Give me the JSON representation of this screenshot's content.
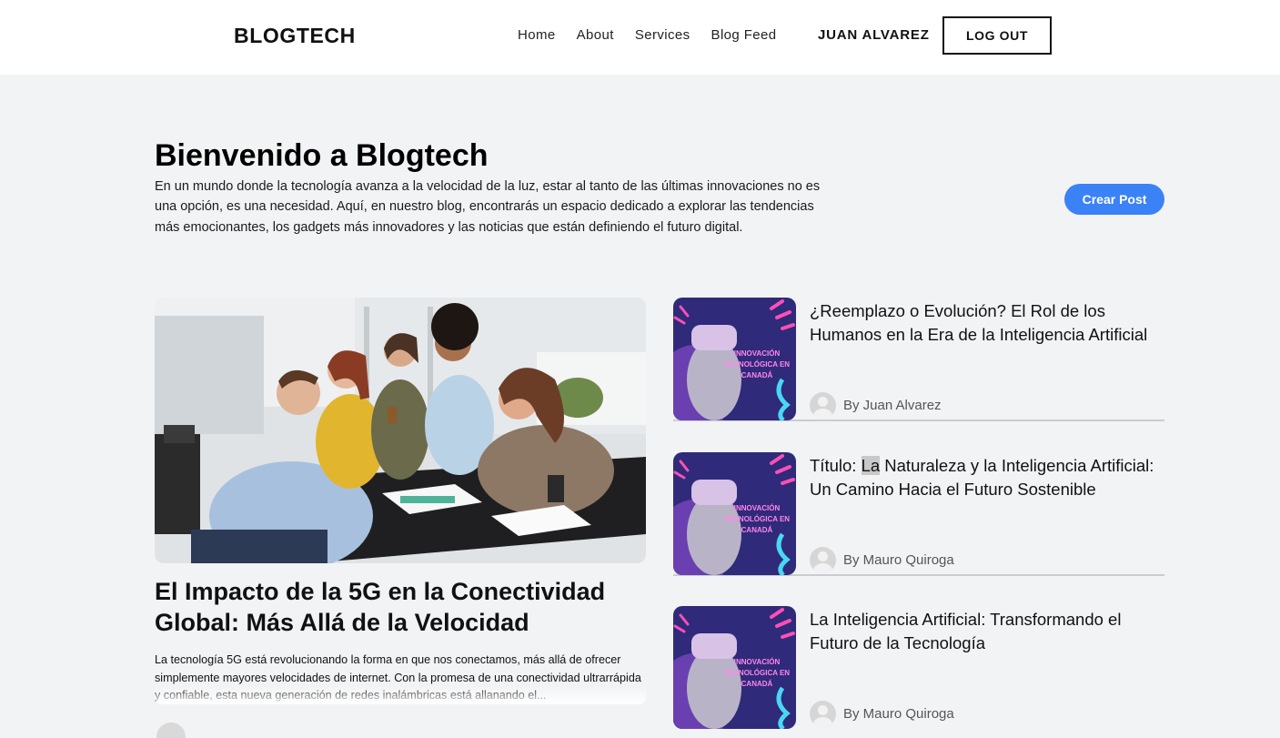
{
  "header": {
    "brand": "BLOGTECH",
    "nav": [
      {
        "label": "Home"
      },
      {
        "label": "About"
      },
      {
        "label": "Services"
      },
      {
        "label": "Blog Feed"
      }
    ],
    "user_name": "JUAN ALVAREZ",
    "logout_label": "LOG OUT"
  },
  "hero": {
    "title": "Bienvenido a Blogtech",
    "text": "En un mundo donde la tecnología avanza a la velocidad de la luz, estar al tanto de las últimas innovaciones no es una opción, es una necesidad. Aquí, en nuestro blog, encontrarás un espacio dedicado a explorar las tendencias más emocionantes, los gadgets más innovadores y las noticias que están definiendo el futuro digital.",
    "create_label": "Crear Post"
  },
  "featured": {
    "title": "El Impacto de la 5G en la Conectividad Global: Más Allá de la Velocidad",
    "excerpt": "La tecnología 5G está revolucionando la forma en que nos conectamos, más allá de ofrecer simplemente mayores velocidades de internet. Con la promesa de una conectividad ultrarrápida y confiable, esta nueva generación de redes inalámbricas está allanando el..."
  },
  "posts": [
    {
      "title": "¿Reemplazo o Evolución? El Rol de los Humanos en la Era de la Inteligencia Artificial",
      "author": "By Juan Alvarez",
      "thumb_text": "INNOVACIÓN TECNOLÓGICA EN CANADÁ"
    },
    {
      "title_prefix": "Título: ",
      "title_highlight": "La",
      "title_rest": " Naturaleza y la Inteligencia Artificial: Un Camino Hacia el Futuro Sostenible",
      "author": "By Mauro Quiroga",
      "thumb_text": "INNOVACIÓN TECNOLÓGICA EN CANADÁ"
    },
    {
      "title": "La Inteligencia Artificial: Transformando el Futuro de la Tecnología",
      "author": "By Mauro Quiroga",
      "thumb_text": "INNOVACIÓN TECNOLÓGICA EN CANADÁ"
    }
  ],
  "colors": {
    "accent": "#3b82f6",
    "background": "#f2f3f5"
  }
}
